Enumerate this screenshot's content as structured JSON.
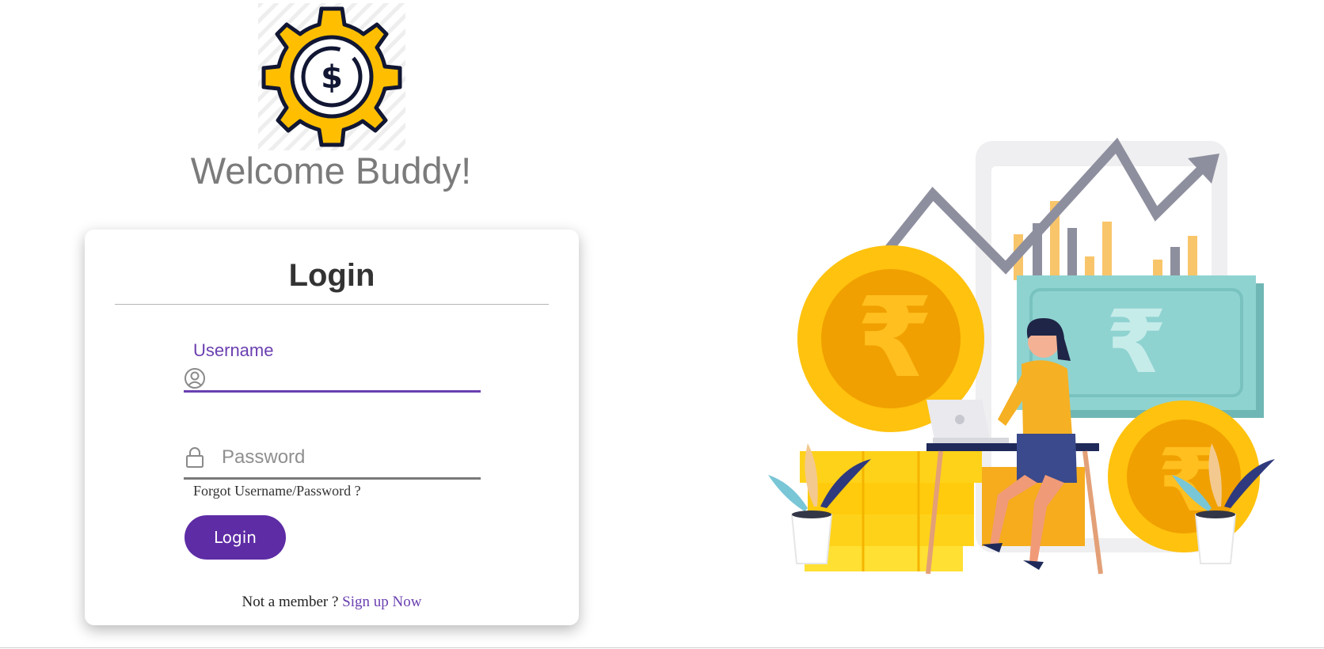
{
  "header": {
    "welcome_text": "Welcome Buddy!",
    "logo_icon": "gear-dollar-icon"
  },
  "login_card": {
    "title": "Login",
    "username": {
      "label": "Username",
      "value": "",
      "icon": "user-circle-icon"
    },
    "password": {
      "placeholder": "Password",
      "value": "",
      "icon": "lock-icon"
    },
    "forgot_text": "Forgot Username/Password ?",
    "submit_label": "Login",
    "signup_prompt": "Not a member ?",
    "signup_link": "Sign up Now"
  },
  "illustration": {
    "description_icon": "finance-illustration",
    "currency_symbol": "₹"
  },
  "colors": {
    "accent": "#5e2ca5",
    "accent_text": "#6a3fb0",
    "coin_yellow": "#ffc20e",
    "coin_dark": "#f0a000",
    "note_teal": "#8fd3d1",
    "chart_gray": "#8e8f9e"
  }
}
